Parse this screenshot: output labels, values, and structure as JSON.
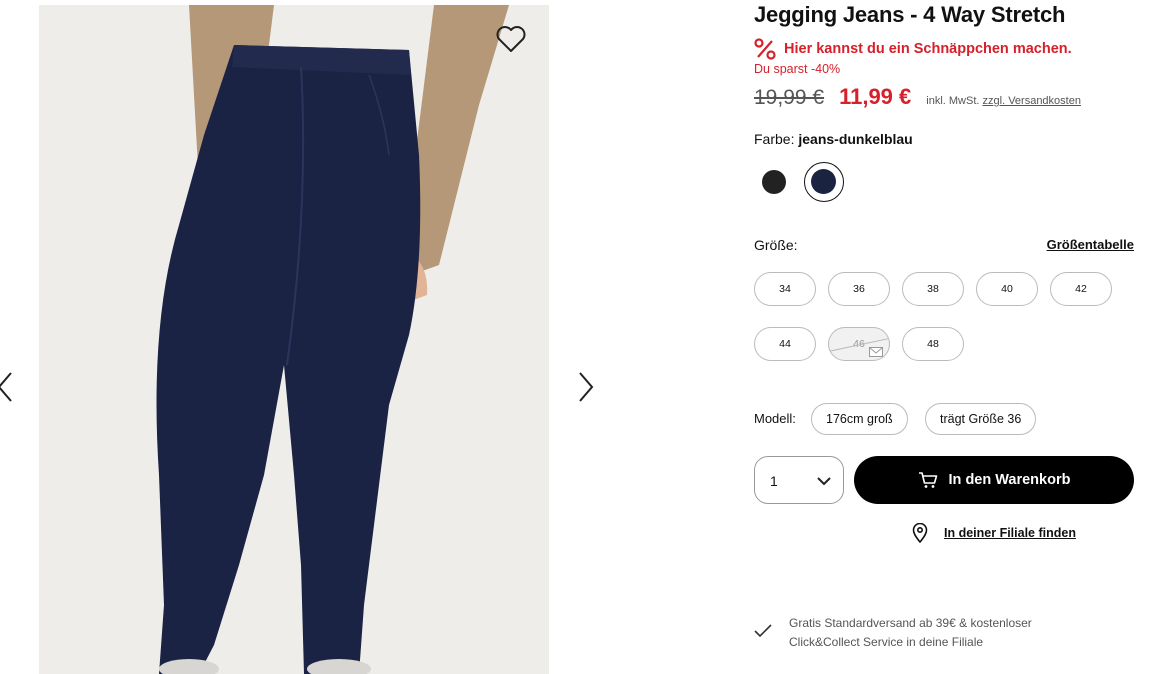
{
  "product": {
    "title": "Jegging Jeans - 4 Way Stretch",
    "deal_text": "Hier kannst du ein Schnäppchen machen.",
    "savings_text": "Du sparst -40%",
    "old_price": "19,99 €",
    "new_price": "11,99 €",
    "vat_prefix": "inkl. MwSt.",
    "shipping_link": "zzgl. Versandkosten",
    "color_label": "Farbe:",
    "color_value": "jeans-dunkelblau",
    "swatches": [
      {
        "name": "schwarz",
        "color": "#222222"
      },
      {
        "name": "jeans-dunkelblau",
        "color": "#1a2440",
        "selected": true
      }
    ],
    "size_label": "Größe:",
    "size_chart_link": "Größentabelle",
    "sizes": [
      {
        "label": "34",
        "available": true
      },
      {
        "label": "36",
        "available": true
      },
      {
        "label": "38",
        "available": true
      },
      {
        "label": "40",
        "available": true
      },
      {
        "label": "42",
        "available": true
      },
      {
        "label": "44",
        "available": true
      },
      {
        "label": "46",
        "available": false
      },
      {
        "label": "48",
        "available": true
      }
    ],
    "model_label": "Modell:",
    "model_height": "176cm groß",
    "model_size": "trägt Größe 36",
    "quantity": "1",
    "add_to_cart": "In den Warenkorb",
    "find_store": "In deiner Filiale finden",
    "shipping_line1": "Gratis Standardversand ab 39€ & kostenloser",
    "shipping_line2": "Click&Collect Service in deine Filiale"
  },
  "colors": {
    "sale_red": "#d6202a",
    "button_black": "#000000",
    "jeans_navy": "#1a2440"
  },
  "icons": {
    "wishlist": "heart-icon",
    "prev": "chevron-left-icon",
    "next": "chevron-right-icon",
    "deal": "percent-icon",
    "cart": "cart-icon",
    "store": "location-pin-icon",
    "shipping": "checkmark-icon",
    "notify": "mail-icon",
    "quantity": "chevron-down-icon"
  }
}
